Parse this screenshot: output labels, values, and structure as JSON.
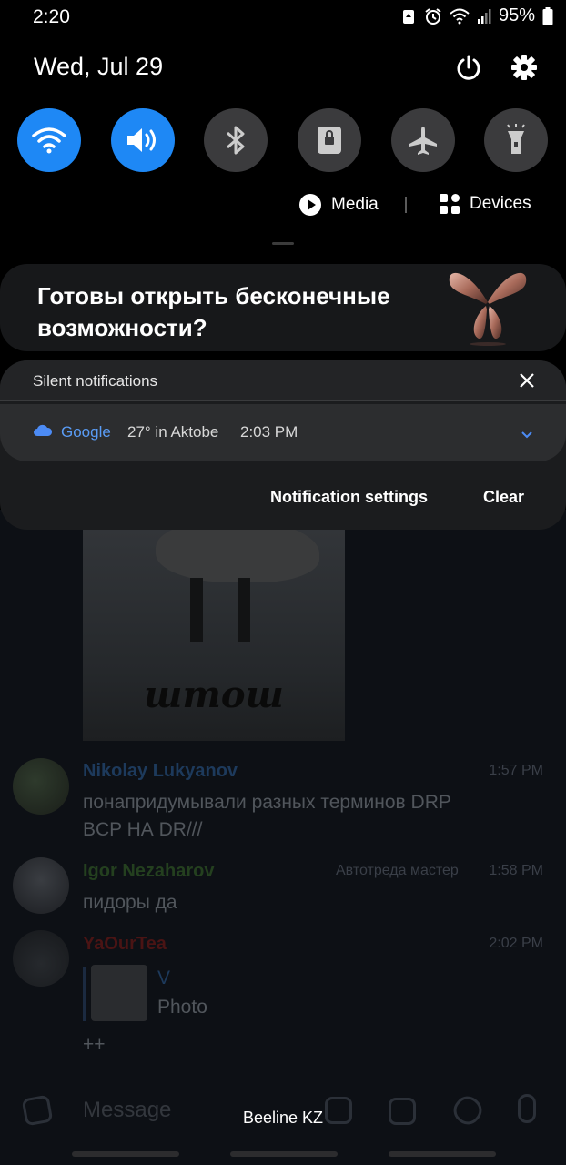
{
  "status_bar": {
    "time": "2:20",
    "battery": "95%",
    "icons": [
      "recycle-icon",
      "alarm-icon",
      "wifi-icon",
      "signal-icon",
      "battery-icon"
    ]
  },
  "quick_panel": {
    "date": "Wed, Jul 29",
    "toggles": [
      {
        "name": "wifi",
        "icon": "wifi-icon",
        "on": true
      },
      {
        "name": "sound",
        "icon": "sound-icon",
        "on": true
      },
      {
        "name": "bluetooth",
        "icon": "bluetooth-icon",
        "on": false
      },
      {
        "name": "screen-lock",
        "icon": "lock-icon",
        "on": false
      },
      {
        "name": "airplane",
        "icon": "airplane-icon",
        "on": false
      },
      {
        "name": "flashlight",
        "icon": "flashlight-icon",
        "on": false
      }
    ],
    "media_label": "Media",
    "devices_label": "Devices",
    "accent": "#1e88f5"
  },
  "banner": {
    "text": "Готовы открыть бесконечные возможности?"
  },
  "silent": {
    "title": "Silent notifications",
    "app": "Google",
    "weather": "27° in Aktobe",
    "time": "2:03 PM",
    "settings_label": "Notification settings",
    "clear_label": "Clear"
  },
  "chat": {
    "photo_caption": "штош",
    "messages": [
      {
        "name": "Nikolay Lukyanov",
        "time": "1:57 PM",
        "text_lines": [
          "понапридумывали разных терминов DRP",
          "BCP НА DR///"
        ],
        "name_color": "#1d3a5c"
      },
      {
        "name": "Igor Nezaharov",
        "tag": "Автотреда мастер",
        "time": "1:58 PM",
        "text_lines": [
          "пидоры да"
        ],
        "name_color": "#24401f"
      },
      {
        "name": "YaOurTea",
        "time": "2:02 PM",
        "reply_from": "V",
        "reply_text": "Photo",
        "text_lines": [
          "++"
        ],
        "name_color": "#4a1414"
      }
    ],
    "composer_placeholder": "Message"
  },
  "carrier": "Beeline KZ"
}
